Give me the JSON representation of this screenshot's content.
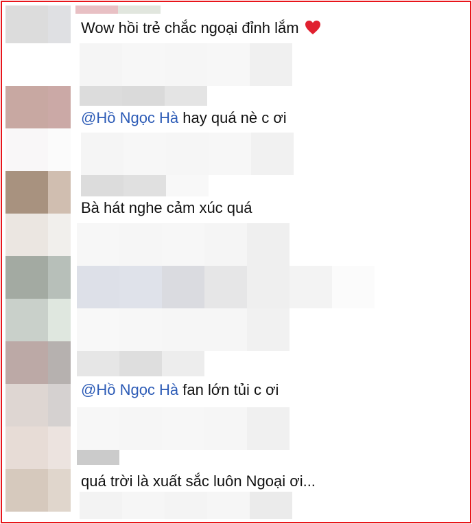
{
  "comments": [
    {
      "text": "Wow hồi trẻ chắc ngoại đỉnh lắm",
      "reaction_icon": "red-heart-emoji"
    },
    {
      "mention": "@Hồ Ngọc Hà",
      "text": " hay quá nè c ơi"
    },
    {
      "text": "Bà hát nghe cảm xúc quá"
    },
    {
      "mention": "@Hồ Ngọc Hà",
      "text": " fan lớn tủi c ơi"
    },
    {
      "text": "quá trời là xuất sắc luôn Ngoại ơi..."
    }
  ],
  "colors": {
    "border": "#e8151b",
    "mention": "#2c5bb6",
    "text": "#111111",
    "heart": "#e0202f"
  }
}
